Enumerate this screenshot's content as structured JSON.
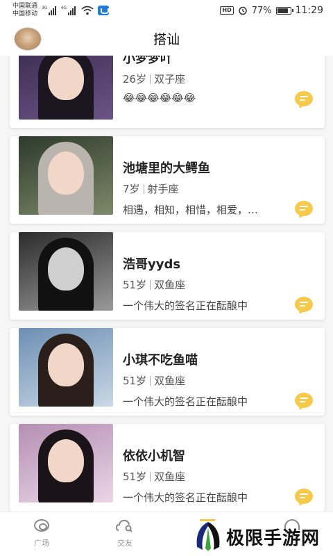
{
  "status_bar": {
    "carrier1": "中国联通",
    "carrier2": "中国移动",
    "net1": "3G",
    "net2": "4G",
    "hd": "HD",
    "battery_percent": "77%",
    "battery_level": 0.77,
    "time": "11:29"
  },
  "header": {
    "title": "搭讪"
  },
  "users": [
    {
      "name": "小梦梦吖",
      "age": "26岁",
      "sign": "双子座",
      "signature": "😂😂😂😂😂😂",
      "photo_colors": [
        "#3b2b4e",
        "#6a5486"
      ]
    },
    {
      "name": "池塘里的大鳄鱼",
      "age": "7岁",
      "sign": "射手座",
      "signature": "相遇，相知，相惜，相爱，…",
      "photo_colors": [
        "#2e3a2c",
        "#7c8a6a"
      ]
    },
    {
      "name": "浩哥yyds",
      "age": "51岁",
      "sign": "双鱼座",
      "signature": "一个伟大的签名正在酝酿中",
      "photo_colors": [
        "#2b2b2b",
        "#9a9a9a"
      ]
    },
    {
      "name": "小琪不吃鱼喵",
      "age": "51岁",
      "sign": "双鱼座",
      "signature": "一个伟大的签名正在酝酿中",
      "photo_colors": [
        "#6d8fb3",
        "#c9d8e6"
      ]
    },
    {
      "name": "依依小机智",
      "age": "51岁",
      "sign": "双鱼座",
      "signature": "一个伟大的签名正在酝酿中",
      "photo_colors": [
        "#b58fb3",
        "#e9d6e6"
      ]
    }
  ],
  "tabs": [
    {
      "label": "广场",
      "icon": "eye-ring-icon"
    },
    {
      "label": "交友",
      "icon": "cloud-search-icon"
    }
  ],
  "watermark": {
    "text": "极限手游网"
  },
  "colors": {
    "accent": "#f6c94a",
    "background": "#f6f6f6"
  }
}
